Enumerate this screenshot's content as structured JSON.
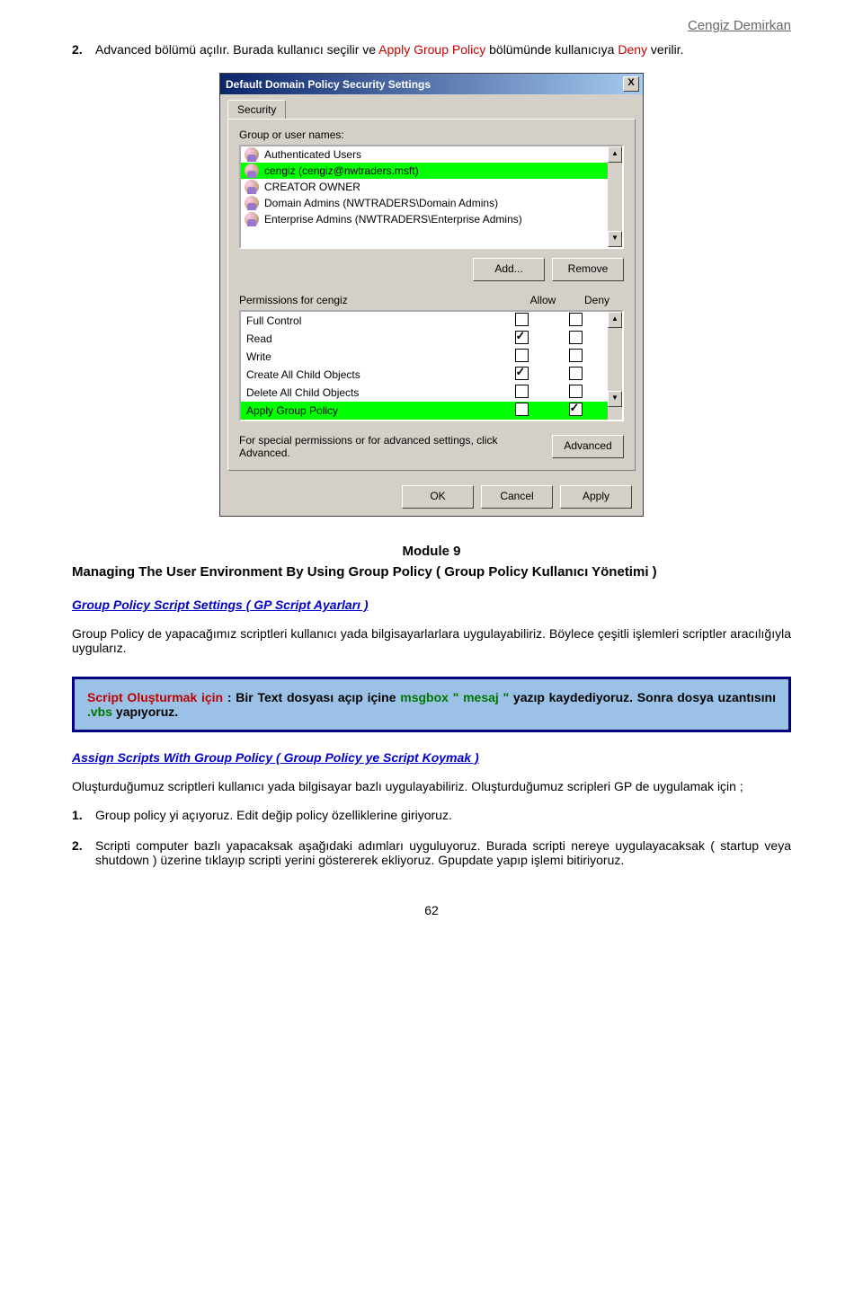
{
  "header": {
    "author": "Cengiz Demirkan"
  },
  "intro": {
    "num": "2.",
    "p1": "Advanced bölümü açılır. Burada kullanıcı seçilir ve ",
    "p2": "Apply Group Policy",
    "p3": " bölümünde kullanıcıya ",
    "p4": "Deny",
    "p5": "verilir."
  },
  "dialog": {
    "title": "Default Domain Policy Security Settings",
    "close": "X",
    "tab": "Security",
    "group_label": "Group or user names:",
    "users": [
      {
        "name": "Authenticated Users",
        "sel": false
      },
      {
        "name": "cengiz (cengiz@nwtraders.msft)",
        "sel": true
      },
      {
        "name": "CREATOR OWNER",
        "sel": false
      },
      {
        "name": "Domain Admins (NWTRADERS\\Domain Admins)",
        "sel": false
      },
      {
        "name": "Enterprise Admins (NWTRADERS\\Enterprise Admins)",
        "sel": false
      }
    ],
    "add": "Add...",
    "remove": "Remove",
    "perm_for": "Permissions for cengiz",
    "allow": "Allow",
    "deny": "Deny",
    "perms": [
      {
        "name": "Full Control",
        "allow": false,
        "deny": false,
        "sel": false
      },
      {
        "name": "Read",
        "allow": true,
        "deny": false,
        "sel": false
      },
      {
        "name": "Write",
        "allow": false,
        "deny": false,
        "sel": false
      },
      {
        "name": "Create All Child Objects",
        "allow": true,
        "deny": false,
        "sel": false
      },
      {
        "name": "Delete All Child Objects",
        "allow": false,
        "deny": false,
        "sel": false
      },
      {
        "name": "Apply Group Policy",
        "allow": false,
        "deny": true,
        "sel": true
      }
    ],
    "adv_text": "For special permissions or for advanced settings, click Advanced.",
    "advanced": "Advanced",
    "ok": "OK",
    "cancel": "Cancel",
    "apply": "Apply"
  },
  "module": {
    "num": "Module 9",
    "title": "Managing The User Environment By Using  Group Policy ( Group Policy Kullanıcı Yönetimi  )"
  },
  "sec1": {
    "title": "Group Policy Script Settings ( GP Script Ayarları )"
  },
  "para1": "Group Policy de yapacağımız scriptleri kullanıcı yada bilgisayarlarlara uygulayabiliriz. Böylece çeşitli işlemleri scriptler aracılığıyla uygularız.",
  "callout": {
    "p1": "Script Oluşturmak için",
    "p2": " : Bir Text dosyası açıp içine ",
    "p3": "msgbox \" mesaj \"",
    "p4": "  yazıp kaydediyoruz. Sonra dosya uzantısını ",
    "p5": ".vbs",
    "p6": " yapıyoruz."
  },
  "sec2": {
    "title": "Assign Scripts With Group Policy ( Group Policy ye Script Koymak )"
  },
  "para2": "Oluşturduğumuz scriptleri kullanıcı yada bilgisayar bazlı uygulayabiliriz. Oluşturduğumuz scripleri GP de uygulamak için ;",
  "steps": {
    "n1": "1.",
    "s1": "Group policy yi açıyoruz. Edit değip policy özelliklerine giriyoruz.",
    "n2": "2.",
    "s2": "Scripti computer bazlı yapacaksak aşağıdaki adımları uyguluyoruz. Burada scripti nereye uygulayacaksak ( startup veya shutdown ) üzerine tıklayıp scripti yerini göstererek ekliyoruz. Gpupdate yapıp işlemi bitiriyoruz."
  },
  "page_num": "62"
}
